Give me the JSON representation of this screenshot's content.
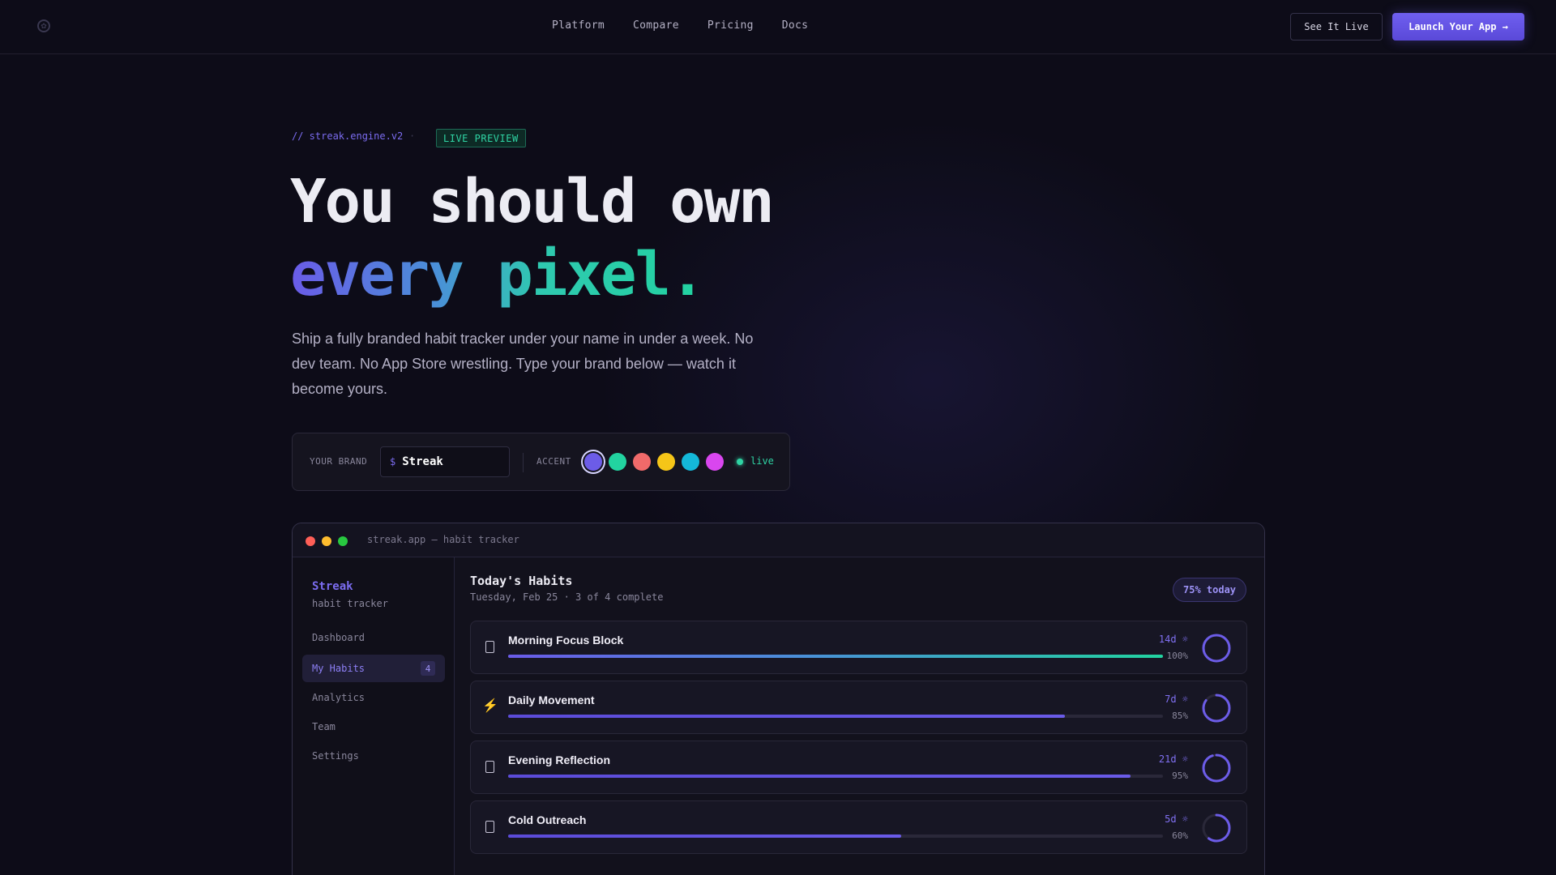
{
  "nav": {
    "links": [
      "Platform",
      "Compare",
      "Pricing",
      "Docs"
    ],
    "see_live": "See It Live",
    "launch": "Launch Your App →"
  },
  "hero": {
    "tagline": "// streak.engine.v2",
    "badge": "LIVE PREVIEW",
    "headline_1": "You should own",
    "headline_2": "every pixel.",
    "lede": "Ship a fully branded habit tracker under your name in under a week. No dev team. No App Store wrestling. Type your brand below — watch it become yours."
  },
  "brand_bar": {
    "label": "YOUR BRAND",
    "prefix": "$",
    "value": "Streak",
    "accent_label": "ACCENT",
    "accents": [
      "#6c5ce7",
      "#22d3a0",
      "#f06a6a",
      "#f5c518",
      "#14b8d9",
      "#d946ef"
    ],
    "selected_accent": 0,
    "status": "live"
  },
  "app": {
    "window_title": "streak.app — habit tracker",
    "sidebar": {
      "brand": "Streak",
      "subtitle": "habit tracker",
      "items": [
        {
          "label": "Dashboard"
        },
        {
          "label": "My Habits",
          "count": "4"
        },
        {
          "label": "Analytics"
        },
        {
          "label": "Team"
        },
        {
          "label": "Settings"
        }
      ],
      "active_index": 1
    },
    "main": {
      "title": "Today's Habits",
      "subtitle": "Tuesday, Feb 25 · 3 of 4 complete",
      "today_pill": "75% today",
      "habits": [
        {
          "name": "Morning Focus Block",
          "streak": "14d ☼",
          "pct_label": "100%",
          "progress": 1.0,
          "icon": "checkbox-icon"
        },
        {
          "name": "Daily Movement",
          "streak": "7d ☼",
          "pct_label": "85%",
          "progress": 0.85,
          "icon": "lightning-icon"
        },
        {
          "name": "Evening Reflection",
          "streak": "21d ☼",
          "pct_label": "95%",
          "progress": 0.95,
          "icon": "checkbox-icon"
        },
        {
          "name": "Cold Outreach",
          "streak": "5d ☼",
          "pct_label": "60%",
          "progress": 0.6,
          "icon": "checkbox-icon"
        }
      ]
    }
  }
}
